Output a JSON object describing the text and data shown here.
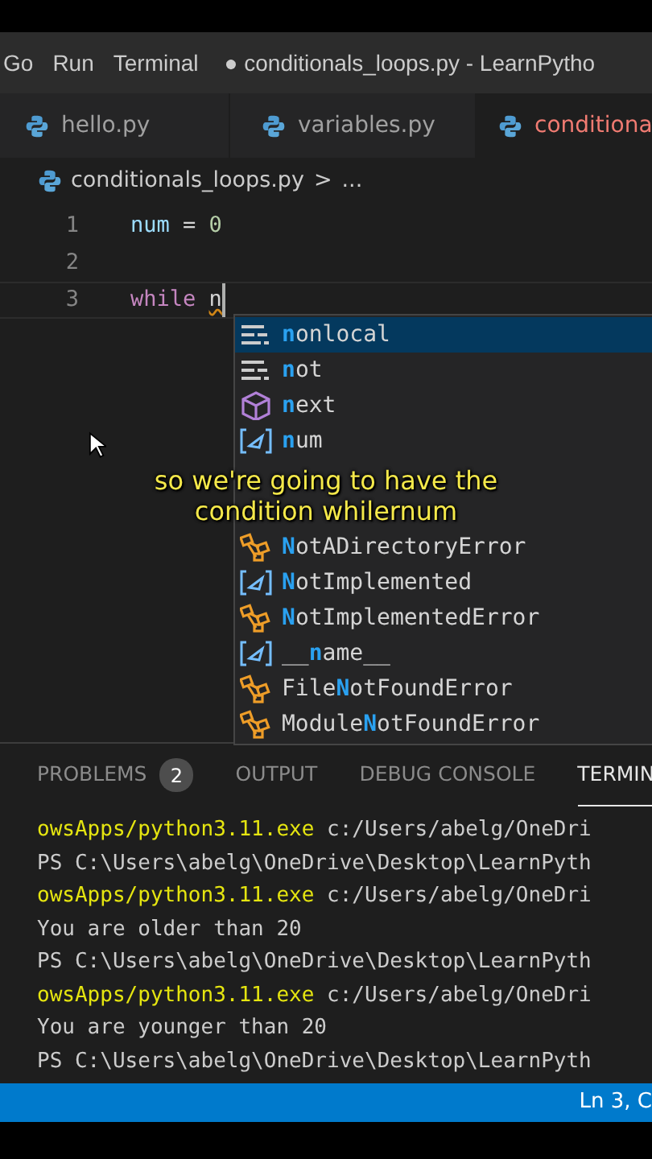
{
  "menu": [
    "Go",
    "Run",
    "Terminal"
  ],
  "window": {
    "title": "● conditionals_loops.py - LearnPytho"
  },
  "tabs": [
    {
      "label": "hello.py",
      "selected": false
    },
    {
      "label": "variables.py",
      "selected": false
    },
    {
      "label": "conditiona",
      "selected": true
    }
  ],
  "breadcrumb": {
    "file": "conditionals_loops.py",
    "separator": ">",
    "rest": "..."
  },
  "editor": {
    "lines": [
      {
        "number": "1",
        "tokens": [
          {
            "kind": "var",
            "text": "num"
          },
          {
            "kind": "op",
            "text": " = "
          },
          {
            "kind": "num",
            "text": "0"
          }
        ]
      },
      {
        "number": "2"
      },
      {
        "number": "3",
        "tokens": [
          {
            "kind": "kw",
            "text": "while "
          },
          {
            "kind": "typing",
            "text": "n"
          }
        ]
      }
    ]
  },
  "suggestions": [
    {
      "kind": "keyword",
      "selected": true,
      "match": "n",
      "after": "onlocal"
    },
    {
      "kind": "keyword",
      "selected": false,
      "match": "n",
      "after": "ot"
    },
    {
      "kind": "module",
      "selected": false,
      "match": "n",
      "after": "ext"
    },
    {
      "kind": "variable",
      "selected": false,
      "match": "n",
      "after": "um"
    },
    {
      "kind": "covered"
    },
    {
      "kind": "covered"
    },
    {
      "kind": "class",
      "selected": false,
      "match": "N",
      "after": "otADirectoryError"
    },
    {
      "kind": "variable",
      "selected": false,
      "match": "N",
      "after": "otImplemented"
    },
    {
      "kind": "class",
      "selected": false,
      "match": "N",
      "after": "otImplementedError"
    },
    {
      "kind": "variable",
      "selected": false,
      "before": "__",
      "match": "n",
      "after": "ame__"
    },
    {
      "kind": "class",
      "selected": false,
      "before": "File",
      "match": "N",
      "after": "otFoundError"
    },
    {
      "kind": "class",
      "selected": false,
      "before": "Module",
      "match": "N",
      "after": "otFoundError"
    }
  ],
  "caption": {
    "lines": [
      "so we're going to have the",
      "condition whilernum"
    ]
  },
  "panel": {
    "tabs": [
      {
        "label": "PROBLEMS",
        "count": "2",
        "selected": false
      },
      {
        "label": "OUTPUT",
        "selected": false
      },
      {
        "label": "DEBUG CONSOLE",
        "selected": false
      },
      {
        "label": "TERMIN",
        "selected": true
      }
    ]
  },
  "terminal": [
    {
      "kind": "command",
      "program": "owsApps/python3.11.exe",
      "args": " c:/Users/abelg/OneDri"
    },
    {
      "kind": "output",
      "text": "PS C:\\Users\\abelg\\OneDrive\\Desktop\\LearnPyth"
    },
    {
      "kind": "command",
      "program": "owsApps/python3.11.exe",
      "args": " c:/Users/abelg/OneDri"
    },
    {
      "kind": "output",
      "text": "You are older than 20"
    },
    {
      "kind": "output",
      "text": "PS C:\\Users\\abelg\\OneDrive\\Desktop\\LearnPyth"
    },
    {
      "kind": "command",
      "program": "owsApps/python3.11.exe",
      "args": " c:/Users/abelg/OneDri"
    },
    {
      "kind": "output",
      "text": "You are younger than 20"
    },
    {
      "kind": "output",
      "text": "PS C:\\Users\\abelg\\OneDrive\\Desktop\\LearnPyth"
    }
  ],
  "status_bar": {
    "position": "Ln 3, C"
  }
}
